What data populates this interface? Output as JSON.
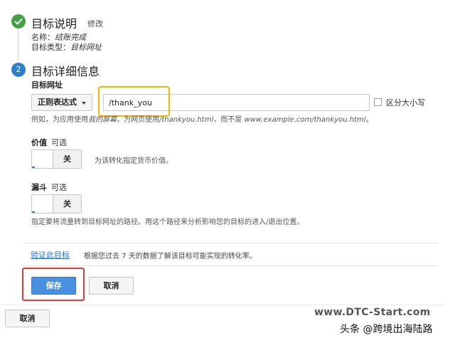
{
  "step1": {
    "title": "目标说明",
    "edit_label": "修改",
    "name_key": "名称：",
    "name_value": "结账完成",
    "type_key": "目标类型：",
    "type_value": "目标网址"
  },
  "step2": {
    "number": "2",
    "title": "目标详细信息",
    "destination": {
      "label": "目标网址",
      "match_type": "正则表达式",
      "value": "/thank_you",
      "case_sensitive_label": "区分大小写",
      "case_sensitive_checked": false,
      "hint_prefix": "例如，为应用使用",
      "hint_i1": "我的屏幕",
      "hint_mid1": "，为网页使用",
      "hint_i2": "/thankyou.html",
      "hint_mid2": "，而不是",
      "hint_i3": "www.example.com/thankyou.html",
      "hint_suffix": "。"
    },
    "value_field": {
      "label": "价值",
      "optional": "可选",
      "toggle_state": "关",
      "hint": "为该转化指定货币价值。"
    },
    "funnel": {
      "label": "漏斗",
      "optional": "可选",
      "toggle_state": "关",
      "hint": "指定要将流量转到目标网址的路径。用这个路径来分析影响您的目标的进入/退出位置。"
    },
    "verify": {
      "link": "验证此目标",
      "desc": "根据您过去 7 天的数据了解该目标可能实现的转化率。"
    },
    "save_label": "保存",
    "cancel_label": "取消"
  },
  "footer": {
    "cancel_label": "取消"
  },
  "watermark": {
    "url": "www.DTC-Start.com",
    "attribution": "头条 @跨境出海陆路"
  },
  "colors": {
    "check_green": "#43a047",
    "step_blue": "#2e7fc6",
    "save_blue": "#4a90e2",
    "highlight_yellow": "#f7b500",
    "highlight_red": "#e53935"
  }
}
